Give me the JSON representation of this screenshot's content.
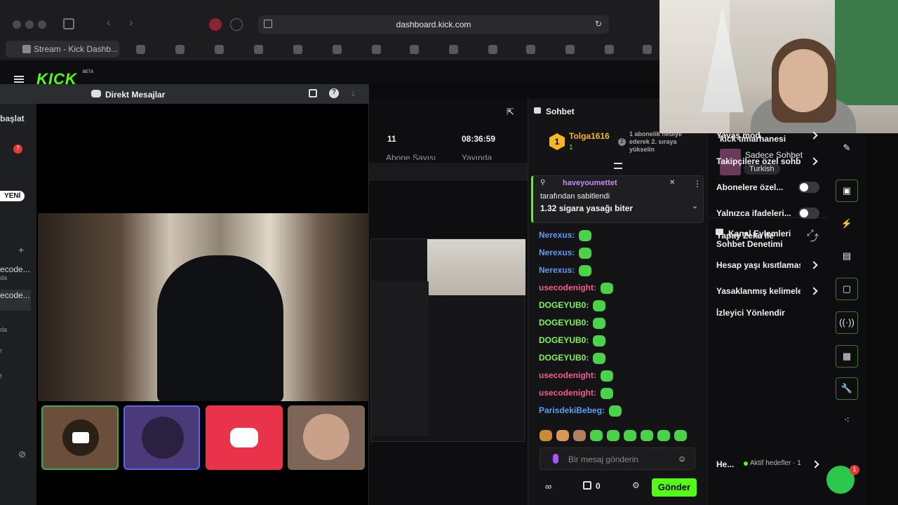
{
  "browser": {
    "url": "dashboard.kick.com",
    "active_tab": "Stream - Kick Dashb...",
    "kick_beta": "BETA"
  },
  "dm": {
    "title": "Direkt Mesajlar",
    "side_items": [
      "başlat",
      "7",
      "YENİ",
      "ecode...",
      "da",
      "ecode...",
      "da",
      "r",
      "t"
    ]
  },
  "dashboard": {
    "subs_value": "11",
    "subs_label": "Abone Sayısı",
    "uptime_value": "08:36:59",
    "uptime_label": "Yayında"
  },
  "chat": {
    "title": "Sohbet",
    "top_user": "Tolga1616",
    "top_rank": "1",
    "top_count": "1",
    "gift_text": "1 abonelik hediye ederek 2. sıraya yükselin",
    "gift_num": "2",
    "pinned_user": "haveyoumettet",
    "pinned_by": "tarafından sabitlendi",
    "pinned_msg": "1.32 sigara yasağı biter",
    "messages": [
      {
        "user": "Nerexus:",
        "color": "#5b9cf4"
      },
      {
        "user": "Nerexus:",
        "color": "#5b9cf4"
      },
      {
        "user": "Nerexus:",
        "color": "#5b9cf4"
      },
      {
        "user": "usecodenight:",
        "color": "#f45b8c"
      },
      {
        "user": "DOGEYUB0:",
        "color": "#7ef45b"
      },
      {
        "user": "DOGEYUB0:",
        "color": "#7ef45b"
      },
      {
        "user": "DOGEYUB0:",
        "color": "#7ef45b"
      },
      {
        "user": "DOGEYUB0:",
        "color": "#7ef45b"
      },
      {
        "user": "usecodenight:",
        "color": "#f45b8c"
      },
      {
        "user": "usecodenight:",
        "color": "#f45b8c"
      },
      {
        "user": "ParisdekiBebeg:",
        "color": "#5b9cf4"
      }
    ],
    "placeholder": "Bir mesaj gönderin",
    "count": "0",
    "send": "Gönder"
  },
  "channel": {
    "name": "kick tımarhanesi",
    "category": "Sadece Sohbet",
    "language": "Turkish",
    "actions_title": "Kanal Eylemleri",
    "actions": [
      {
        "label": "Yavaş mod",
        "kind": "chevron"
      },
      {
        "label": "Takipçilere özel sohbe",
        "kind": "chevron"
      },
      {
        "label": "Abonelere özel...",
        "kind": "toggle"
      },
      {
        "label": "Yalnızca ifadeleri...",
        "kind": "toggle"
      },
      {
        "label": "Yapay Zeka ile Sohbet Denetimi",
        "kind": "external"
      },
      {
        "label": "Hesap yaşı kısıtlaması",
        "kind": "chevron"
      },
      {
        "label": "Yasaklanmış kelimele",
        "kind": "chevron"
      },
      {
        "label": "İzleyici Yönlendir",
        "kind": "none"
      }
    ],
    "goals_short": "He...",
    "goals_label": "Aktif hedefler · 1"
  },
  "support_badge": "1",
  "colors": {
    "accent": "#53fc18",
    "discord": "#e8334a"
  }
}
